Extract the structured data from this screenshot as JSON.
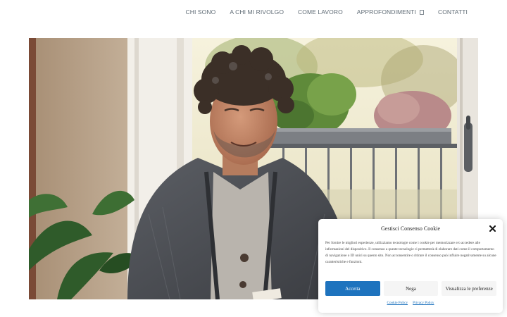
{
  "nav": {
    "items": [
      {
        "label": "CHI SONO"
      },
      {
        "label": "A CHI MI RIVOLGO"
      },
      {
        "label": "COME LAVORO"
      },
      {
        "label": "APPROFONDIMENTI",
        "has_dropdown": true,
        "icon": "chevron-down-icon"
      },
      {
        "label": "CONTATTI"
      }
    ]
  },
  "hero": {
    "image": "photo of a smiling man with curly grey hair in a knitted cardigan, seated by a sunny balcony window with plants"
  },
  "cookie": {
    "title": "Gestisci Consenso Cookie",
    "close_icon": "close-icon",
    "text": "Per fornire le migliori esperienze, utilizziamo tecnologie come i cookie per memorizzare e/o accedere alle informazioni del dispositivo. Il consenso a queste tecnologie ci permetterà di elaborare dati come il comportamento di navigazione o ID unici su questo sito. Non acconsentire o ritirare il consenso può influire negativamente su alcune caratteristiche e funzioni.",
    "buttons": {
      "accept": "Accetta",
      "deny": "Nega",
      "preferences": "Visualizza le preferenze"
    },
    "links": {
      "cookie_policy": "Cookie Policy",
      "privacy_policy": "Privacy Policy"
    }
  },
  "colors": {
    "accent": "#1e73be",
    "nav_text": "#5f6b75",
    "button_light": "#f5f5f5"
  }
}
